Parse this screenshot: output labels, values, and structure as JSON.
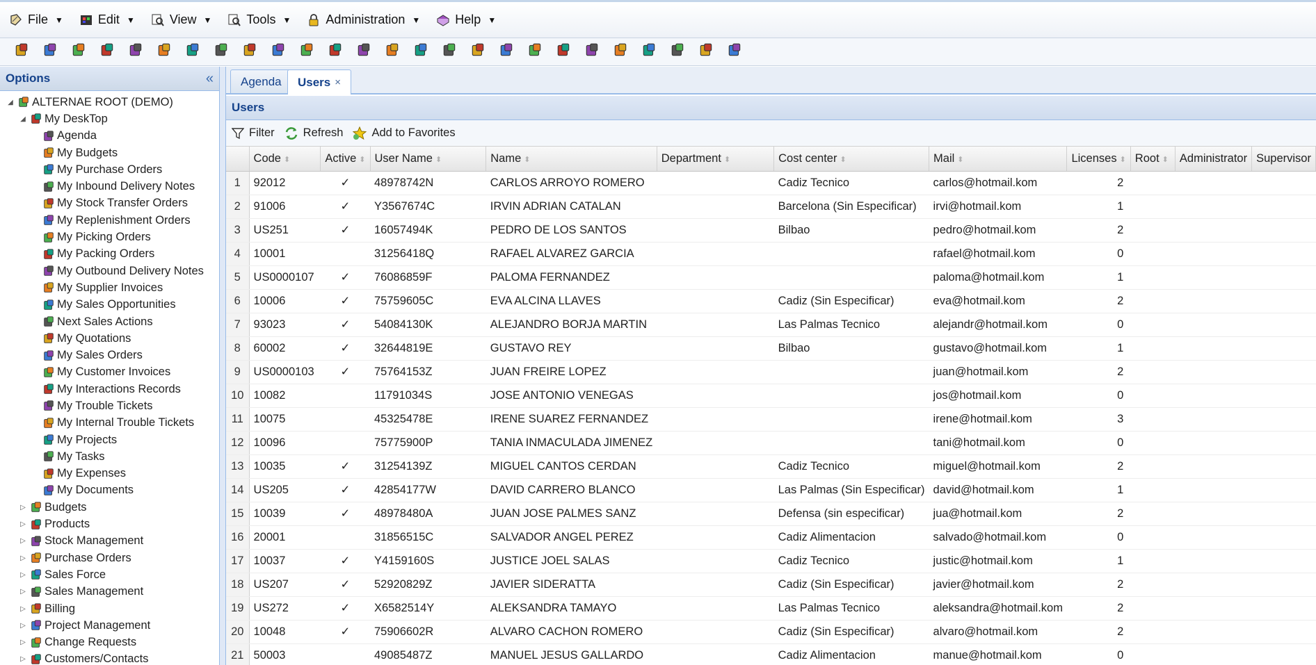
{
  "menus": [
    {
      "label": "File",
      "icon": "file-menu-icon"
    },
    {
      "label": "Edit",
      "icon": "edit-menu-icon"
    },
    {
      "label": "View",
      "icon": "view-menu-icon"
    },
    {
      "label": "Tools",
      "icon": "tools-menu-icon"
    },
    {
      "label": "Administration",
      "icon": "lock-icon"
    },
    {
      "label": "Help",
      "icon": "help-book-icon"
    }
  ],
  "toolbar_icons": [
    "print-icon",
    "cut-icon",
    "copy-icon",
    "paste-icon",
    "calendar-icon",
    "budget-icon",
    "stack-icon",
    "box-icon",
    "users-icon",
    "folder-icon",
    "truck-icon",
    "boxes-icon",
    "chart-icon",
    "inbound-icon",
    "outbound-icon",
    "sales-person-icon",
    "calculator-icon",
    "orders-icon",
    "invoice-icon",
    "supplier-invoice-icon",
    "house-icon",
    "person-icon",
    "ticket-icon",
    "bug-icon",
    "document-icon",
    "projects-icon"
  ],
  "left": {
    "title": "Options",
    "tree": [
      {
        "label": "ALTERNAE ROOT (DEMO)",
        "level": 0,
        "toggle": "◢",
        "icon": "database-icon"
      },
      {
        "label": "My DeskTop",
        "level": 1,
        "toggle": "◢",
        "icon": "desktop-icon"
      },
      {
        "label": "Agenda",
        "level": 2,
        "toggle": "",
        "icon": "agenda-icon"
      },
      {
        "label": "My Budgets",
        "level": 2,
        "toggle": "",
        "icon": "budget-icon"
      },
      {
        "label": "My Purchase Orders",
        "level": 2,
        "toggle": "",
        "icon": "purchase-icon"
      },
      {
        "label": "My Inbound Delivery Notes",
        "level": 2,
        "toggle": "",
        "icon": "inbound-icon"
      },
      {
        "label": "My Stock Transfer Orders",
        "level": 2,
        "toggle": "",
        "icon": "transfer-icon"
      },
      {
        "label": "My Replenishment Orders",
        "level": 2,
        "toggle": "",
        "icon": "replenishment-icon"
      },
      {
        "label": "My Picking Orders",
        "level": 2,
        "toggle": "",
        "icon": "picking-icon"
      },
      {
        "label": "My Packing Orders",
        "level": 2,
        "toggle": "",
        "icon": "packing-icon"
      },
      {
        "label": "My Outbound Delivery Notes",
        "level": 2,
        "toggle": "",
        "icon": "outbound-icon"
      },
      {
        "label": "My Supplier Invoices",
        "level": 2,
        "toggle": "",
        "icon": "supplier-invoice-icon"
      },
      {
        "label": "My Sales Opportunities",
        "level": 2,
        "toggle": "",
        "icon": "opportunity-icon"
      },
      {
        "label": "Next Sales Actions",
        "level": 2,
        "toggle": "",
        "icon": "sales-action-icon"
      },
      {
        "label": "My Quotations",
        "level": 2,
        "toggle": "",
        "icon": "calculator-icon"
      },
      {
        "label": "My Sales Orders",
        "level": 2,
        "toggle": "",
        "icon": "sales-order-icon"
      },
      {
        "label": "My Customer Invoices",
        "level": 2,
        "toggle": "",
        "icon": "customer-invoice-icon"
      },
      {
        "label": "My Interactions Records",
        "level": 2,
        "toggle": "",
        "icon": "interactions-icon"
      },
      {
        "label": "My Trouble Tickets",
        "level": 2,
        "toggle": "",
        "icon": "ticket-icon"
      },
      {
        "label": "My Internal Trouble Tickets",
        "level": 2,
        "toggle": "",
        "icon": "bug-icon"
      },
      {
        "label": "My Projects",
        "level": 2,
        "toggle": "",
        "icon": "projects-icon"
      },
      {
        "label": "My Tasks",
        "level": 2,
        "toggle": "",
        "icon": "tasks-icon"
      },
      {
        "label": "My Expenses",
        "level": 2,
        "toggle": "",
        "icon": "expenses-icon"
      },
      {
        "label": "My Documents",
        "level": 2,
        "toggle": "",
        "icon": "documents-icon"
      },
      {
        "label": "Budgets",
        "level": 1,
        "toggle": "▷",
        "icon": "budget-icon"
      },
      {
        "label": "Products",
        "level": 1,
        "toggle": "▷",
        "icon": "products-icon"
      },
      {
        "label": "Stock Management",
        "level": 1,
        "toggle": "▷",
        "icon": "stock-icon"
      },
      {
        "label": "Purchase Orders",
        "level": 1,
        "toggle": "▷",
        "icon": "purchase-icon"
      },
      {
        "label": "Sales Force",
        "level": 1,
        "toggle": "▷",
        "icon": "sales-force-icon"
      },
      {
        "label": "Sales Management",
        "level": 1,
        "toggle": "▷",
        "icon": "money-bag-icon"
      },
      {
        "label": "Billing",
        "level": 1,
        "toggle": "▷",
        "icon": "billing-icon"
      },
      {
        "label": "Project Management",
        "level": 1,
        "toggle": "▷",
        "icon": "projects-icon"
      },
      {
        "label": "Change Requests",
        "level": 1,
        "toggle": "▷",
        "icon": "change-request-icon"
      },
      {
        "label": "Customers/Contacts",
        "level": 1,
        "toggle": "▷",
        "icon": "customers-icon"
      }
    ]
  },
  "tabs": [
    {
      "label": "Agenda",
      "active": false
    },
    {
      "label": "Users",
      "active": true,
      "close": "×"
    }
  ],
  "grid": {
    "title": "Users",
    "tools": [
      {
        "label": "Filter",
        "icon": "filter-icon"
      },
      {
        "label": "Refresh",
        "icon": "refresh-icon"
      },
      {
        "label": "Add to Favorites",
        "icon": "star-icon"
      }
    ],
    "columns": [
      "",
      "Code",
      "Active",
      "User Name",
      "Name",
      "Department",
      "Cost center",
      "Mail",
      "Licenses",
      "Root",
      "Administrator",
      "Supervisor"
    ],
    "rows": [
      [
        "1",
        "92012",
        "✓",
        "48978742N",
        "CARLOS ARROYO ROMERO",
        "",
        "Cadiz Tecnico",
        "carlos@hotmail.kom",
        "2"
      ],
      [
        "2",
        "91006",
        "✓",
        "Y3567674C",
        "IRVIN ADRIAN CATALAN",
        "",
        "Barcelona (Sin Especificar)",
        "irvi@hotmail.kom",
        "1"
      ],
      [
        "3",
        "US251",
        "✓",
        "16057494K",
        "PEDRO DE LOS SANTOS",
        "",
        "Bilbao",
        "pedro@hotmail.kom",
        "2"
      ],
      [
        "4",
        "10001",
        "",
        "31256418Q",
        "RAFAEL ALVAREZ GARCIA",
        "",
        "",
        "rafael@hotmail.kom",
        "0"
      ],
      [
        "5",
        "US0000107",
        "✓",
        "76086859F",
        "PALOMA FERNANDEZ",
        "",
        "",
        "paloma@hotmail.kom",
        "1"
      ],
      [
        "6",
        "10006",
        "✓",
        "75759605C",
        "EVA ALCINA LLAVES",
        "",
        "Cadiz (Sin Especificar)",
        "eva@hotmail.kom",
        "2"
      ],
      [
        "7",
        "93023",
        "✓",
        "54084130K",
        "ALEJANDRO BORJA MARTIN",
        "",
        "Las Palmas Tecnico",
        "alejandr@hotmail.kom",
        "0"
      ],
      [
        "8",
        "60002",
        "✓",
        "32644819E",
        "GUSTAVO REY",
        "",
        "Bilbao",
        "gustavo@hotmail.kom",
        "1"
      ],
      [
        "9",
        "US0000103",
        "✓",
        "75764153Z",
        "JUAN FREIRE LOPEZ",
        "",
        "",
        "juan@hotmail.kom",
        "2"
      ],
      [
        "10",
        "10082",
        "",
        "11791034S",
        "JOSE ANTONIO VENEGAS",
        "",
        "",
        "jos@hotmail.kom",
        "0"
      ],
      [
        "11",
        "10075",
        "",
        "45325478E",
        "IRENE SUAREZ FERNANDEZ",
        "",
        "",
        "irene@hotmail.kom",
        "3"
      ],
      [
        "12",
        "10096",
        "",
        "75775900P",
        "TANIA INMACULADA JIMENEZ",
        "",
        "",
        "tani@hotmail.kom",
        "0"
      ],
      [
        "13",
        "10035",
        "✓",
        "31254139Z",
        "MIGUEL CANTOS CERDAN",
        "",
        "Cadiz Tecnico",
        "miguel@hotmail.kom",
        "2"
      ],
      [
        "14",
        "US205",
        "✓",
        "42854177W",
        "DAVID CARRERO BLANCO",
        "",
        "Las Palmas (Sin Especificar)",
        "david@hotmail.kom",
        "1"
      ],
      [
        "15",
        "10039",
        "✓",
        "48978480A",
        "JUAN JOSE PALMES SANZ",
        "",
        "Defensa (sin especificar)",
        "jua@hotmail.kom",
        "2"
      ],
      [
        "16",
        "20001",
        "",
        "31856515C",
        "SALVADOR ANGEL PEREZ",
        "",
        "Cadiz Alimentacion",
        "salvado@hotmail.kom",
        "0"
      ],
      [
        "17",
        "10037",
        "✓",
        "Y4159160S",
        "JUSTICE JOEL SALAS",
        "",
        "Cadiz Tecnico",
        "justic@hotmail.kom",
        "1"
      ],
      [
        "18",
        "US207",
        "✓",
        "52920829Z",
        "JAVIER SIDERATTA",
        "",
        "Cadiz (Sin Especificar)",
        "javier@hotmail.kom",
        "2"
      ],
      [
        "19",
        "US272",
        "✓",
        "X6582514Y",
        "ALEKSANDRA TAMAYO",
        "",
        "Las Palmas Tecnico",
        "aleksandra@hotmail.kom",
        "2"
      ],
      [
        "20",
        "10048",
        "✓",
        "75906602R",
        "ALVARO CACHON ROMERO",
        "",
        "Cadiz (Sin Especificar)",
        "alvaro@hotmail.kom",
        "2"
      ],
      [
        "21",
        "50003",
        "",
        "49085487Z",
        "MANUEL JESUS GALLARDO",
        "",
        "Cadiz Alimentacion",
        "manue@hotmail.kom",
        "0"
      ]
    ]
  }
}
